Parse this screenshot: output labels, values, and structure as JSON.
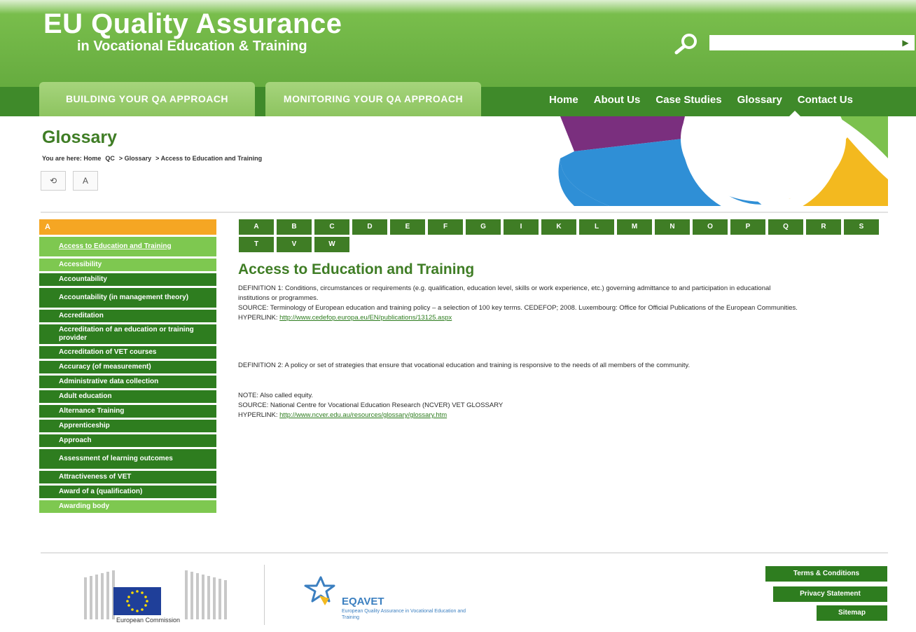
{
  "header": {
    "title": "EU Quality Assurance",
    "subtitle": "in Vocational Education & Training",
    "search": {
      "placeholder": "",
      "icon": "search-icon"
    },
    "qa_tabs": [
      {
        "label": "BUILDING YOUR QA APPROACH"
      },
      {
        "label": "MONITORING YOUR QA APPROACH"
      }
    ],
    "nav": [
      "Home",
      "About Us",
      "Case Studies",
      "Glossary",
      "Contact Us"
    ],
    "active_nav": "Glossary"
  },
  "page": {
    "title": "Glossary",
    "breadcrumb": [
      "You are here: Home",
      "QC",
      "> Glossary",
      "> Access to Education and Training"
    ],
    "util_buttons": [
      "⟲",
      "A"
    ]
  },
  "sidebar": {
    "header": "A",
    "items": [
      {
        "label": "Access to Education and Training",
        "state": "active"
      },
      {
        "label": "Accessibility",
        "state": "light"
      },
      {
        "label": "Accountability",
        "state": "dark"
      },
      {
        "label": "Accountability (in management theory)",
        "state": "dark"
      },
      {
        "label": "Accreditation",
        "state": "dark"
      },
      {
        "label": "Accreditation of an education or training provider",
        "state": "dark"
      },
      {
        "label": "Accreditation of VET courses",
        "state": "dark"
      },
      {
        "label": "Accuracy (of measurement)",
        "state": "dark"
      },
      {
        "label": "Administrative data collection",
        "state": "dark"
      },
      {
        "label": "Adult education",
        "state": "dark"
      },
      {
        "label": "Alternance Training",
        "state": "dark"
      },
      {
        "label": "Apprenticeship",
        "state": "dark"
      },
      {
        "label": "Approach",
        "state": "dark"
      },
      {
        "label": "Assessment of learning outcomes",
        "state": "dark"
      },
      {
        "label": "Attractiveness of VET",
        "state": "dark"
      },
      {
        "label": "Award of a (qualification)",
        "state": "dark"
      },
      {
        "label": "Awarding body",
        "state": "light"
      }
    ]
  },
  "alphabet": [
    "A",
    "B",
    "C",
    "D",
    "E",
    "F",
    "G",
    "I",
    "K",
    "L",
    "M",
    "N",
    "O",
    "P",
    "Q",
    "R",
    "S",
    "T",
    "V",
    "W"
  ],
  "entry": {
    "title": "Access to Education and Training",
    "definition1_text": "DEFINITION 1: Conditions, circumstances or requirements (e.g. qualification, education level, skills or work experience, etc.) governing admittance to and participation in educational institutions or programmes.",
    "source1_text": "SOURCE: Terminology of European education and training policy – a selection of 100 key terms. CEDEFOP; 2008. Luxembourg: Office for Official Publications of the European Communities.",
    "hyperlink_prefix": "HYPERLINK:",
    "hyperlink1": "http://www.cedefop.europa.eu/EN/publications/13125.aspx",
    "definition2_text": "DEFINITION 2: A policy or set of strategies that ensure that vocational education and training is responsive to the needs of all members of the community.",
    "note_text": "NOTE: Also called equity.",
    "source2_text": "SOURCE: National Centre for Vocational Education Research (NCVER) VET GLOSSARY",
    "hyperlink2": "http://www.ncver.edu.au/resources/glossary/glossary.htm"
  },
  "footer": {
    "ec_caption": "European Commission",
    "eqavet_name": "EQAVET",
    "eqavet_tagline": "European Quality Assurance in Vocational Education and Training",
    "links": [
      "Terms & Conditions",
      "Privacy Statement",
      "Sitemap"
    ]
  },
  "colors": {
    "header_green": "#6cb143",
    "nav_green": "#3f8a2a",
    "dark_green": "#2e7d1f",
    "light_green": "#7ec850",
    "accent_orange": "#f5a623",
    "title_green": "#3f7d25"
  }
}
